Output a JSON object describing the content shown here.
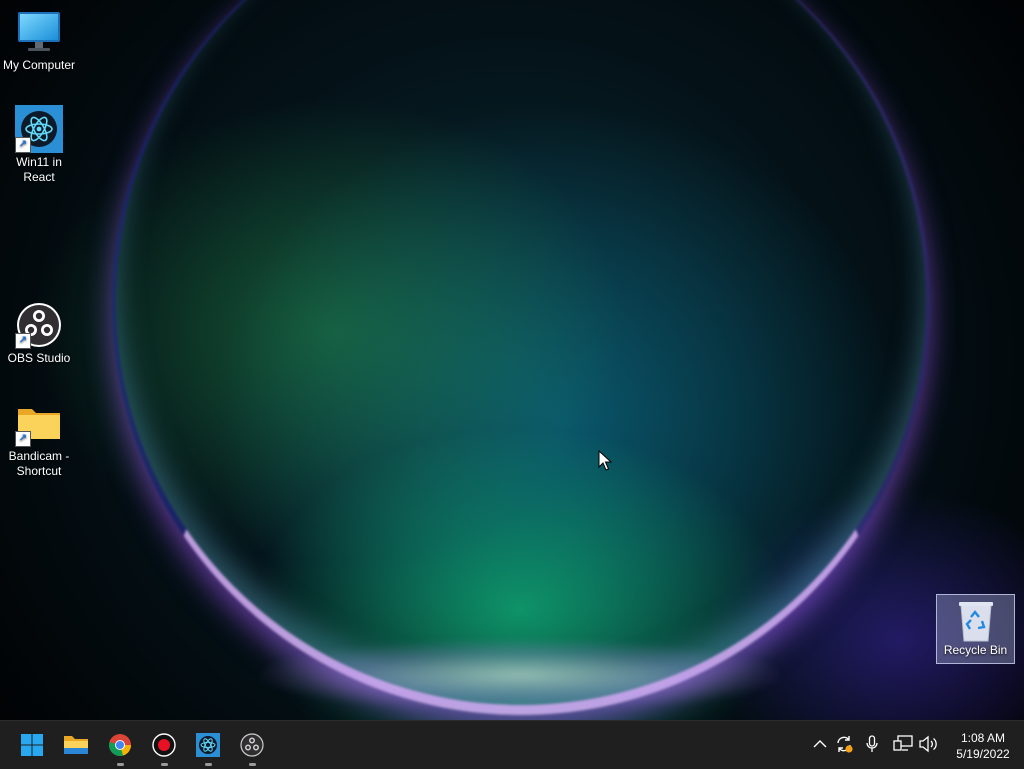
{
  "desktop": {
    "icons": [
      {
        "label": "My Computer",
        "icon": "monitor-icon",
        "shortcut": false
      },
      {
        "label": "Win11 in React",
        "icon": "react-icon",
        "shortcut": true
      },
      {
        "label": "OBS Studio",
        "icon": "obs-icon",
        "shortcut": true
      },
      {
        "label": "Bandicam - Shortcut",
        "icon": "folder-icon",
        "shortcut": true
      }
    ],
    "recycle_bin": {
      "label": "Recycle Bin",
      "icon": "recycle-bin-icon",
      "selected": true
    }
  },
  "taskbar": {
    "apps": [
      {
        "name": "Start",
        "icon": "windows-start-icon",
        "running": false
      },
      {
        "name": "File Explorer",
        "icon": "folder-icon",
        "running": false
      },
      {
        "name": "Google Chrome",
        "icon": "chrome-icon",
        "running": true
      },
      {
        "name": "Bandicam",
        "icon": "record-icon",
        "running": true
      },
      {
        "name": "Win11 in React",
        "icon": "react-icon",
        "running": true
      },
      {
        "name": "OBS Studio",
        "icon": "obs-icon",
        "running": true
      }
    ],
    "tray": [
      {
        "icon": "chevron-up-icon"
      },
      {
        "icon": "sync-icon"
      },
      {
        "icon": "microphone-icon"
      },
      {
        "icon": "network-icon"
      },
      {
        "icon": "volume-icon"
      }
    ],
    "clock": {
      "time": "1:08 AM",
      "date": "5/19/2022"
    }
  },
  "colors": {
    "taskbar": "#1f1f1f",
    "accent": "#0078d4",
    "chrome_red": "#db4437",
    "chrome_green": "#0f9d58",
    "chrome_yellow": "#f4b400",
    "folder": "#f8c840",
    "record": "#e81123"
  }
}
